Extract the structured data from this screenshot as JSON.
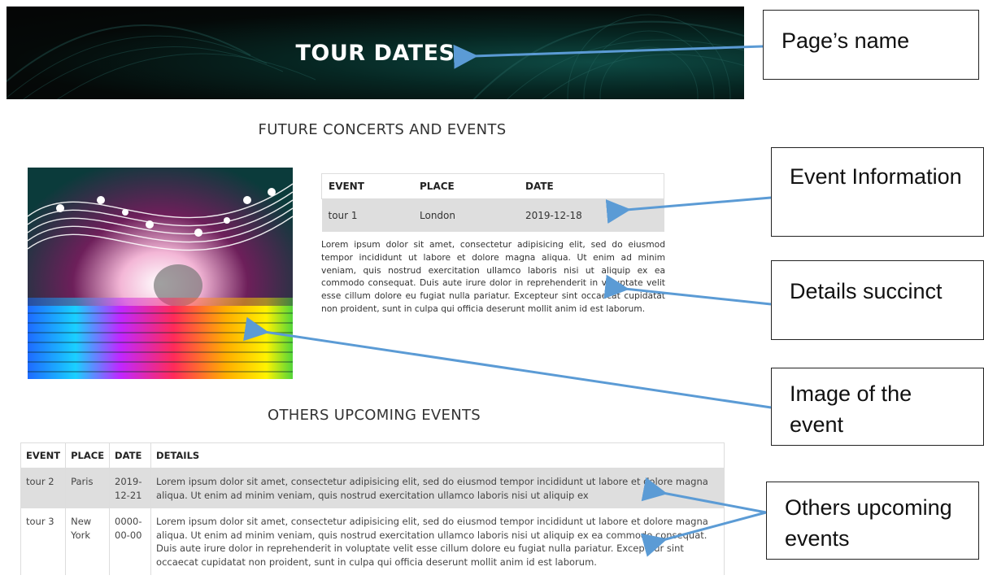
{
  "banner": {
    "title": "TOUR DATES"
  },
  "future": {
    "heading": "FUTURE CONCERTS AND EVENTS",
    "table": {
      "headers": [
        "EVENT",
        "PLACE",
        "DATE"
      ],
      "row": {
        "event": "tour 1",
        "place": "London",
        "date": "2019-12-18"
      }
    },
    "details": "Lorem ipsum dolor sit amet, consectetur adipisicing elit, sed do eiusmod tempor incididunt ut labore et dolore magna aliqua. Ut enim ad minim veniam, quis nostrud exercitation ullamco laboris nisi ut aliquip ex ea commodo consequat. Duis aute irure dolor in reprehenderit in voluptate velit esse cillum dolore eu fugiat nulla pariatur. Excepteur sint occaecat cupidatat non proident, sunt in culpa qui officia deserunt mollit anim id est laborum."
  },
  "others": {
    "heading": "OTHERS UPCOMING EVENTS",
    "headers": [
      "EVENT",
      "PLACE",
      "DATE",
      "DETAILS"
    ],
    "rows": [
      {
        "event": "tour 2",
        "place": "Paris",
        "date": "2019-12-21",
        "details": "Lorem ipsum dolor sit amet, consectetur adipisicing elit, sed do eiusmod tempor incididunt ut labore et dolore magna aliqua. Ut enim ad minim veniam, quis nostrud exercitation ullamco laboris nisi ut aliquip ex"
      },
      {
        "event": "tour 3",
        "place": "New York",
        "date": "0000-00-00",
        "details": "Lorem ipsum dolor sit amet, consectetur adipisicing elit, sed do eiusmod tempor incididunt ut labore et dolore magna aliqua. Ut enim ad minim veniam, quis nostrud exercitation ullamco laboris nisi ut aliquip ex ea commodo consequat. Duis aute irure dolor in reprehenderit in voluptate velit esse cillum dolore eu fugiat nulla pariatur. Excepteur sint occaecat cupidatat non proident, sunt in culpa qui officia deserunt mollit anim id est laborum."
      }
    ]
  },
  "annotations": {
    "page_name": "Page’s name",
    "event_information": "Event Information",
    "details_succinct": "Details succinct",
    "image_of_event": "Image of the event",
    "others_upcoming": "Others upcoming events"
  },
  "colors": {
    "arrow": "#5b9bd5",
    "row_shade": "#dedede"
  }
}
